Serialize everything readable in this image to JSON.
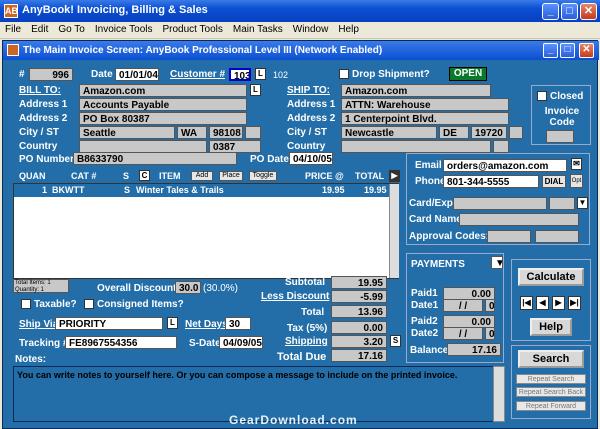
{
  "window": {
    "title": "AnyBook! Invoicing, Billing & Sales",
    "app_icon": "AB"
  },
  "menu": [
    "File",
    "Edit",
    "Go To",
    "Invoice Tools",
    "Product Tools",
    "Main Tasks",
    "Window",
    "Help"
  ],
  "inner_title": "The Main Invoice Screen: AnyBook Professional Level III (Network Enabled)",
  "header": {
    "num_label": "#",
    "num": "996",
    "date_label": "Date",
    "date": "01/01/04",
    "customer_label": "Customer #",
    "customer": "103",
    "customer_extra": "102",
    "drop_label": "Drop Shipment?",
    "status": "OPEN"
  },
  "bill": {
    "label": "BILL TO:",
    "name": "Amazon.com",
    "a1_label": "Address 1",
    "a1": "Accounts Payable",
    "a2_label": "Address 2",
    "a2": "PO Box 80387",
    "cs_label": "City / ST",
    "city": "Seattle",
    "st": "WA",
    "zip": "98108",
    "country_label": "Country",
    "code": "0387"
  },
  "ship": {
    "label": "SHIP TO:",
    "name": "Amazon.com",
    "a1_label": "Address 1",
    "a1": "ATTN: Warehouse",
    "a2_label": "Address 2",
    "a2": "1 Centerpoint Blvd.",
    "cs_label": "City / ST",
    "city": "Newcastle",
    "st": "DE",
    "zip": "19720",
    "country_label": "Country"
  },
  "closed": {
    "label": "Closed",
    "code_label": "Invoice Code"
  },
  "po": {
    "num_label": "PO Number",
    "num": "B8633790",
    "date_label": "PO Date",
    "date": "04/10/05"
  },
  "contact": {
    "email_label": "Email",
    "email": "orders@amazon.com",
    "phone_label": "Phone",
    "phone": "801-344-5555",
    "dial": "DIAL",
    "opt": "Opt",
    "card_label": "Card/Exp",
    "cardname_label": "Card Name",
    "approval_label": "Approval Codes:"
  },
  "items": {
    "headers": [
      "QUAN",
      "CAT #",
      "S",
      "C",
      "ITEM",
      "PRICE @",
      "TOTAL"
    ],
    "add": "Add",
    "place": "Place",
    "toggle": "Toggle",
    "row": {
      "qty": "1",
      "cat": "BKWTT",
      "s": "S",
      "item": "Winter Tales & Trails",
      "price": "19.95",
      "total": "19.95"
    },
    "summary1": "Total Items: 1",
    "summary2": "Quantity: 1"
  },
  "discount": {
    "label": "Overall Discount",
    "value": "30.0",
    "pct": "(30.0%)"
  },
  "taxable": "Taxable?",
  "consigned": "Consigned Items?",
  "ship_via": {
    "label": "Ship Via",
    "value": "PRIORITY",
    "netdays_label": "Net Days",
    "netdays": "30"
  },
  "tracking": {
    "label": "Tracking #",
    "value": "FE8967554356",
    "sdate_label": "S-Date",
    "sdate": "04/09/05"
  },
  "totals": {
    "subtotal_label": "Subtotal",
    "subtotal": "19.95",
    "less_label": "Less Discount",
    "less": "-5.99",
    "total_label": "Total",
    "total": "13.96",
    "tax_label": "Tax (5%)",
    "tax": "0.00",
    "shipping_label": "Shipping",
    "shipping": "3.20",
    "due_label": "Total Due",
    "due": "17.16"
  },
  "payments": {
    "label": "PAYMENTS",
    "paid1_label": "Paid1",
    "paid1": "0.00",
    "date1_label": "Date1",
    "date1": "/ /",
    "d1v": "0",
    "paid2_label": "Paid2",
    "paid2": "0.00",
    "date2_label": "Date2",
    "date2": "/ /",
    "d2v": "0",
    "balance_label": "Balance",
    "balance": "17.16"
  },
  "actions": {
    "calculate": "Calculate",
    "help": "Help",
    "search": "Search",
    "repeat_search": "Repeat Search",
    "repeat_back": "Repeat Search Back",
    "repeat_forward": "Repeat Forward"
  },
  "notes": {
    "label": "Notes:",
    "text": "You can write notes to yourself here.  Or you can compose a message to include on the printed invoice."
  },
  "watermark": "GearDownload.com"
}
